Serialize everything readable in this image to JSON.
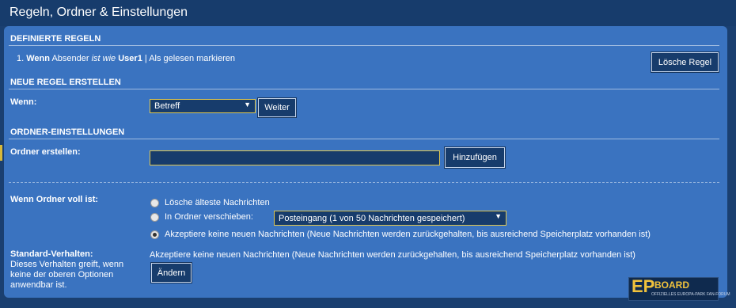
{
  "header": {
    "title": "Regeln, Ordner & Einstellungen"
  },
  "defined_rules": {
    "title": "DEFINIERTE REGELN",
    "rule": {
      "number": "1.",
      "when": "Wenn",
      "field": "Absender",
      "operator": "ist wie",
      "value": "User1",
      "separator": "|",
      "action": "Als gelesen markieren"
    },
    "delete_button": "Lösche Regel"
  },
  "new_rule": {
    "title": "NEUE REGEL ERSTELLEN",
    "when_label": "Wenn:",
    "select_value": "Betreff",
    "next_button": "Weiter"
  },
  "folder_settings": {
    "title": "ORDNER-EINSTELLUNGEN",
    "create_label": "Ordner erstellen:",
    "create_input_value": "",
    "add_button": "Hinzufügen",
    "full_label": "Wenn Ordner voll ist:",
    "options": [
      {
        "label": "Lösche älteste Nachrichten",
        "checked": false
      },
      {
        "label": "In Ordner verschieben:",
        "checked": false
      },
      {
        "label": "Akzeptiere keine neuen Nachrichten (Neue Nachrichten werden zurückgehalten, bis ausreichend Speicherplatz vorhanden ist)",
        "checked": true
      }
    ],
    "move_target": "Posteingang (1 von 50 Nachrichten gespeichert)",
    "default_label": "Standard-Verhalten:",
    "default_desc": "Dieses Verhalten greift, wenn keine der oberen Optionen anwendbar ist.",
    "default_value": "Akzeptiere keine neuen Nachrichten (Neue Nachrichten werden zurückgehalten, bis ausreichend Speicherplatz vorhanden ist)",
    "change_button": "Ändern"
  },
  "logo": {
    "big": "EP",
    "board": "-BOARD",
    "small": "OFFIZIELLES EUROPA-PARK FAN-FORUM"
  }
}
